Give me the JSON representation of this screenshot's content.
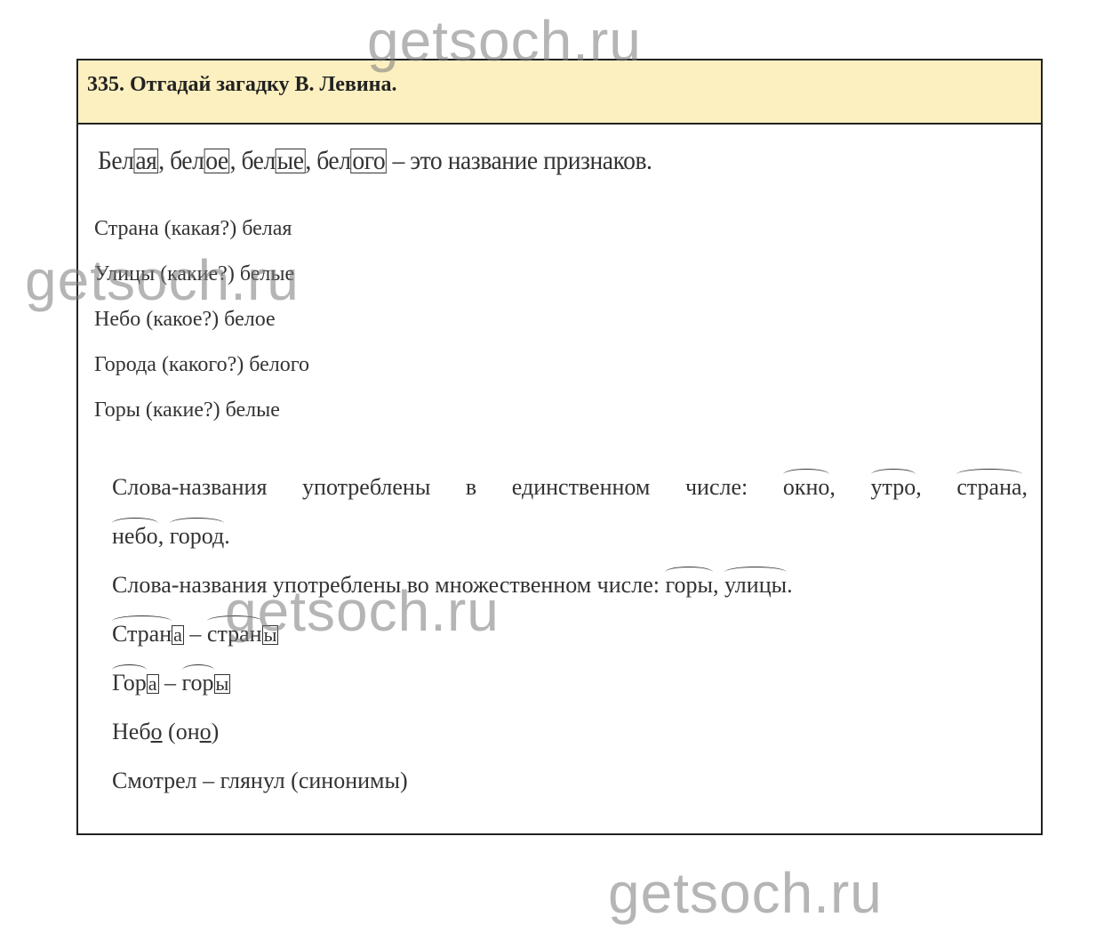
{
  "watermark": "getsoch.ru",
  "header": {
    "title": "335. Отгадай загадку В. Левина."
  },
  "line1": {
    "w1_root": "Бел",
    "w1_end": "ая",
    "sep1": ",  ",
    "w2_root": "бел",
    "w2_end": "ое",
    "sep2": ", ",
    "w3_root": "бел",
    "w3_end": "ые",
    "sep3": ", ",
    "w4_root": "бел",
    "w4_end": "ого",
    "tail": " – это название признаков."
  },
  "list": [
    "Страна (какая?) белая",
    "Улицы (какие?) белые",
    "Небо (какое?) белое",
    "Города (какого?) белого",
    "Горы (какие?) белые"
  ],
  "section2": {
    "singular_lead": "Слова-названия употреблены в единственном числе:",
    "singular_w1": "окно",
    "singular_w2": "утро",
    "singular_w3": "страна",
    "singular_w4": "небо",
    "singular_w5": "город",
    "plural_lead": "Слова-названия употреблены во множественном числе:",
    "plural_w1": "горы",
    "plural_w2": "улицы",
    "r1_a_root": "Стран",
    "r1_a_end": "а",
    "r1_dash": " – ",
    "r1_b_root": "стран",
    "r1_b_end": "ы",
    "r2_a_root": "Гор",
    "r2_a_end": "а",
    "r2_dash": " – ",
    "r2_b_root": "гор",
    "r2_b_end": "ы",
    "r3_a": "Неб",
    "r3_a_u": "о",
    "r3_b": " (он",
    "r3_b_u": "о",
    "r3_c": ")",
    "r4": "Смотрел – глянул (синонимы)"
  }
}
